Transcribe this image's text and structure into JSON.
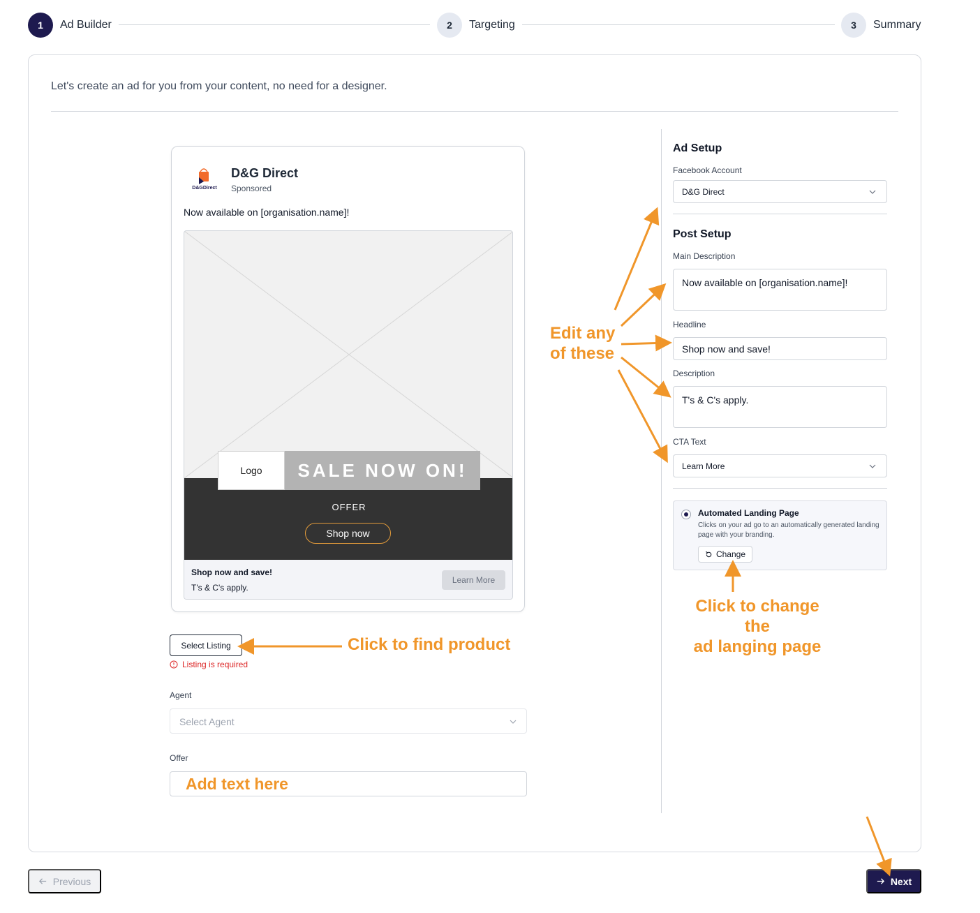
{
  "stepper": {
    "steps": [
      {
        "number": "1",
        "label": "Ad Builder",
        "state": "active"
      },
      {
        "number": "2",
        "label": "Targeting",
        "state": "inactive"
      },
      {
        "number": "3",
        "label": "Summary",
        "state": "inactive"
      }
    ]
  },
  "intro": "Let's create an ad for you from your content, no need for a designer.",
  "preview": {
    "brand_name": "D&G Direct",
    "brand_logo_text": "D&GDirect",
    "sponsored": "Sponsored",
    "post_text": "Now available on [organisation.name]!",
    "logo_label": "Logo",
    "sale_text": "SALE NOW ON!",
    "offer_label": "OFFER",
    "shop_button": "Shop now",
    "footer_headline": "Shop now and save!",
    "footer_description": "T's & C's apply.",
    "footer_cta": "Learn More"
  },
  "left_form": {
    "select_listing": "Select Listing",
    "listing_error": "Listing is required",
    "agent_label": "Agent",
    "agent_placeholder": "Select Agent",
    "offer_label": "Offer"
  },
  "right_panel": {
    "ad_setup_title": "Ad Setup",
    "facebook_account_label": "Facebook Account",
    "facebook_account_value": "D&G Direct",
    "post_setup_title": "Post Setup",
    "main_description_label": "Main Description",
    "main_description_value": "Now available on [organisation.name]!",
    "headline_label": "Headline",
    "headline_value": "Shop now and save!",
    "description_label": "Description",
    "description_value": "T's & C's apply.",
    "cta_label": "CTA Text",
    "cta_value": "Learn More",
    "landing_title": "Automated Landing Page",
    "landing_description": "Clicks on your ad go to an automatically generated landing page with your branding.",
    "change_button": "Change"
  },
  "nav": {
    "previous": "Previous",
    "next": "Next"
  },
  "annotations": {
    "edit_line1": "Edit any",
    "edit_line2": "of these",
    "find_product": "Click to find product",
    "add_text": "Add text here",
    "change_line1": "Click to change the",
    "change_line2": "ad langing page"
  },
  "colors": {
    "primary": "#1e1a4f",
    "annotation": "#f0962a",
    "error": "#dc2626",
    "cta_outline": "#e39b3a",
    "brand_orange": "#f26b2a"
  }
}
